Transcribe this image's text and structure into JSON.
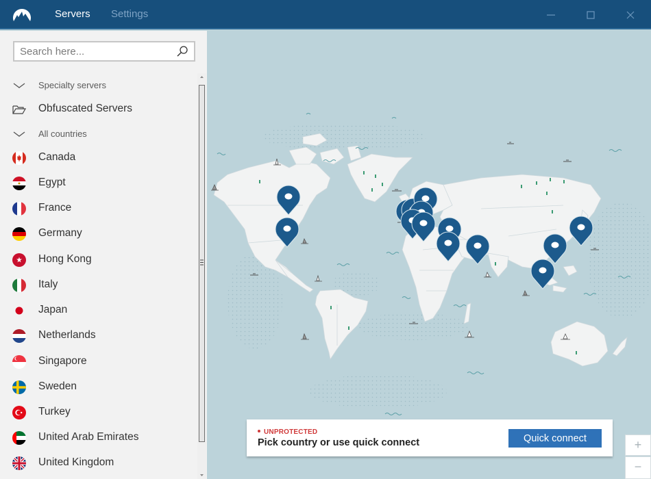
{
  "app": {
    "tabs": [
      {
        "label": "Servers",
        "active": true
      },
      {
        "label": "Settings",
        "active": false
      }
    ],
    "window_controls": [
      "minimize-icon",
      "maximize-icon",
      "close-icon"
    ]
  },
  "sidebar": {
    "search": {
      "placeholder": "Search here...",
      "value": ""
    },
    "items": [
      {
        "type": "header",
        "label": "Specialty servers",
        "icon": "chevron-down-icon"
      },
      {
        "type": "item",
        "label": "Obfuscated Servers",
        "icon": "folder-icon"
      },
      {
        "type": "header",
        "label": "All countries",
        "icon": "chevron-down-icon"
      },
      {
        "type": "country",
        "label": "Canada",
        "flag": "canada"
      },
      {
        "type": "country",
        "label": "Egypt",
        "flag": "egypt"
      },
      {
        "type": "country",
        "label": "France",
        "flag": "france"
      },
      {
        "type": "country",
        "label": "Germany",
        "flag": "germany"
      },
      {
        "type": "country",
        "label": "Hong Kong",
        "flag": "hong-kong"
      },
      {
        "type": "country",
        "label": "Italy",
        "flag": "italy"
      },
      {
        "type": "country",
        "label": "Japan",
        "flag": "japan"
      },
      {
        "type": "country",
        "label": "Netherlands",
        "flag": "netherlands"
      },
      {
        "type": "country",
        "label": "Singapore",
        "flag": "singapore"
      },
      {
        "type": "country",
        "label": "Sweden",
        "flag": "sweden"
      },
      {
        "type": "country",
        "label": "Turkey",
        "flag": "turkey"
      },
      {
        "type": "country",
        "label": "United Arab Emirates",
        "flag": "uae"
      },
      {
        "type": "country",
        "label": "United Kingdom",
        "flag": "uk"
      }
    ]
  },
  "map": {
    "pins": [
      {
        "location": "Canada"
      },
      {
        "location": "United States"
      },
      {
        "location": "United Kingdom"
      },
      {
        "location": "Netherlands"
      },
      {
        "location": "France"
      },
      {
        "location": "Germany"
      },
      {
        "location": "Sweden"
      },
      {
        "location": "Italy"
      },
      {
        "location": "Turkey"
      },
      {
        "location": "Egypt"
      },
      {
        "location": "United Arab Emirates"
      },
      {
        "location": "Hong Kong"
      },
      {
        "location": "Japan"
      },
      {
        "location": "Singapore"
      }
    ],
    "zoom_in_label": "+",
    "zoom_out_label": "−"
  },
  "status": {
    "state": "UNPROTECTED",
    "message": "Pick country or use quick connect",
    "quick_connect_label": "Quick connect"
  },
  "colors": {
    "titlebar": "#174f7c",
    "accent_button": "#2f72b8",
    "pin": "#1c5a8c",
    "unprotected": "#d03a3a",
    "ocean": "#bcd3da",
    "land": "#f2f3f3"
  }
}
